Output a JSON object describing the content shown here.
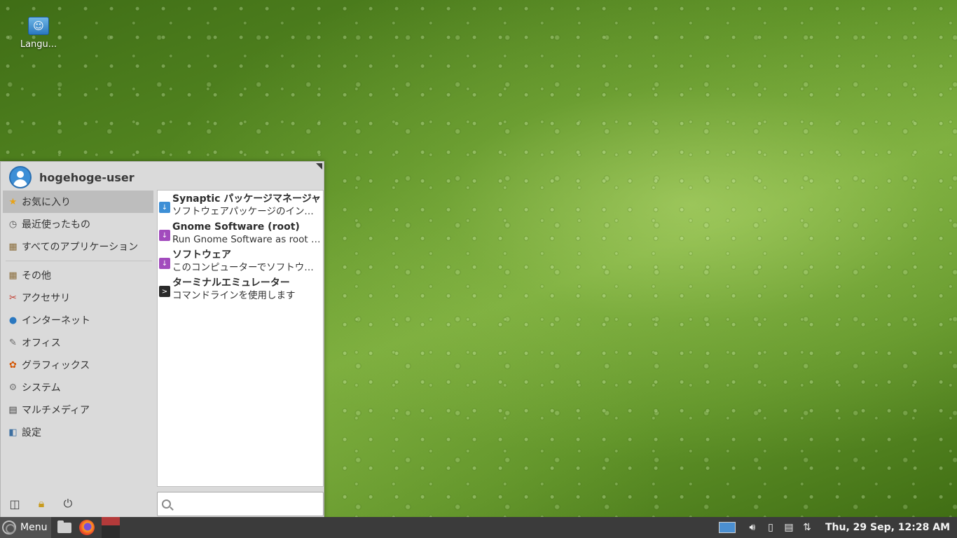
{
  "desktop": {
    "icons": [
      {
        "label": "Langu...",
        "icon": "language-flag-icon"
      }
    ]
  },
  "menu": {
    "user": "hogehoge-user",
    "categories": [
      {
        "label": "お気に入り",
        "icon": "star-icon",
        "active": true
      },
      {
        "label": "最近使ったもの",
        "icon": "history-icon"
      },
      {
        "label": "すべてのアプリケーション",
        "icon": "folder-icon"
      },
      {
        "label": "その他",
        "icon": "folder-icon"
      },
      {
        "label": "アクセサリ",
        "icon": "accessories-icon"
      },
      {
        "label": "インターネット",
        "icon": "globe-icon"
      },
      {
        "label": "オフィス",
        "icon": "office-icon"
      },
      {
        "label": "グラフィックス",
        "icon": "palette-icon"
      },
      {
        "label": "システム",
        "icon": "gear-icon"
      },
      {
        "label": "マルチメディア",
        "icon": "film-icon"
      },
      {
        "label": "設定",
        "icon": "settings-icon"
      }
    ],
    "apps": [
      {
        "name": "Synaptic パッケージマネージャ",
        "desc": "ソフトウェアパッケージのインストール",
        "icon": "synaptic-icon",
        "color": "#3d8fd6"
      },
      {
        "name": "Gnome Software (root)",
        "desc": "Run Gnome Software as root user",
        "icon": "software-icon",
        "color": "#a24bbd"
      },
      {
        "name": "ソフトウェア",
        "desc": "このコンピューターでソフトウェアを追加・削除",
        "icon": "software-icon",
        "color": "#a24bbd"
      },
      {
        "name": "ターミナルエミュレーター",
        "desc": "コマンドラインを使用します",
        "icon": "terminal-icon",
        "color": "#2b2b2b"
      }
    ],
    "search": {
      "value": "",
      "placeholder": ""
    },
    "footer_buttons": [
      "settings-manager-icon",
      "lock-icon",
      "power-icon"
    ]
  },
  "panel": {
    "menu_label": "Menu",
    "launchers": [
      "file-manager-icon",
      "firefox-icon"
    ],
    "clock": "Thu, 29 Sep, 12:28 AM",
    "tray": [
      "workspace-icon",
      "volume-icon",
      "battery-icon",
      "clipboard-icon",
      "network-icon"
    ]
  }
}
